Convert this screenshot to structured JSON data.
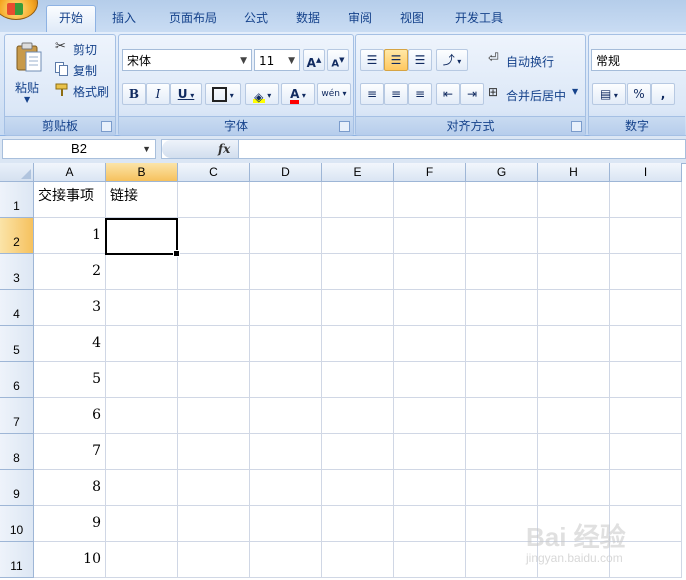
{
  "tabs": [
    {
      "label": "开始",
      "active": true
    },
    {
      "label": "插入"
    },
    {
      "label": "页面布局"
    },
    {
      "label": "公式"
    },
    {
      "label": "数据"
    },
    {
      "label": "审阅"
    },
    {
      "label": "视图"
    },
    {
      "label": "开发工具"
    }
  ],
  "ribbon": {
    "clipboard": {
      "label": "剪贴板",
      "paste": "粘贴",
      "cut": "剪切",
      "copy": "复制",
      "format_painter": "格式刷"
    },
    "font": {
      "label": "字体",
      "font_name": "宋体",
      "font_size": "11",
      "grow": "A",
      "shrink": "A",
      "bold": "B",
      "italic": "I",
      "underline": "U",
      "font_color_glyph": "A",
      "phonetic": "wén"
    },
    "alignment": {
      "label": "对齐方式",
      "wrap_text": "自动换行",
      "merge_center": "合并后居中"
    },
    "number": {
      "label": "数字",
      "format": "常规",
      "percent": "%",
      "comma": ","
    }
  },
  "formula_bar": {
    "name_box": "B2",
    "fx": "fx",
    "content": ""
  },
  "sheet": {
    "columns": [
      "A",
      "B",
      "C",
      "D",
      "E",
      "F",
      "G",
      "H",
      "I"
    ],
    "selected_column": "B",
    "selected_row": "2",
    "rows": [
      {
        "num": "1",
        "a": "交接事项",
        "b": "链接"
      },
      {
        "num": "2",
        "a": "1",
        "b": ""
      },
      {
        "num": "3",
        "a": "2",
        "b": ""
      },
      {
        "num": "4",
        "a": "3",
        "b": ""
      },
      {
        "num": "5",
        "a": "4",
        "b": ""
      },
      {
        "num": "6",
        "a": "5",
        "b": ""
      },
      {
        "num": "7",
        "a": "6",
        "b": ""
      },
      {
        "num": "8",
        "a": "7",
        "b": ""
      },
      {
        "num": "9",
        "a": "8",
        "b": ""
      },
      {
        "num": "10",
        "a": "9",
        "b": ""
      },
      {
        "num": "11",
        "a": "10",
        "b": ""
      }
    ]
  },
  "watermark": {
    "brand": "Bai 经验",
    "url": "jingyan.baidu.com"
  },
  "colors": {
    "selected_header": "#f6c15e",
    "ribbon_text": "#15428b"
  }
}
